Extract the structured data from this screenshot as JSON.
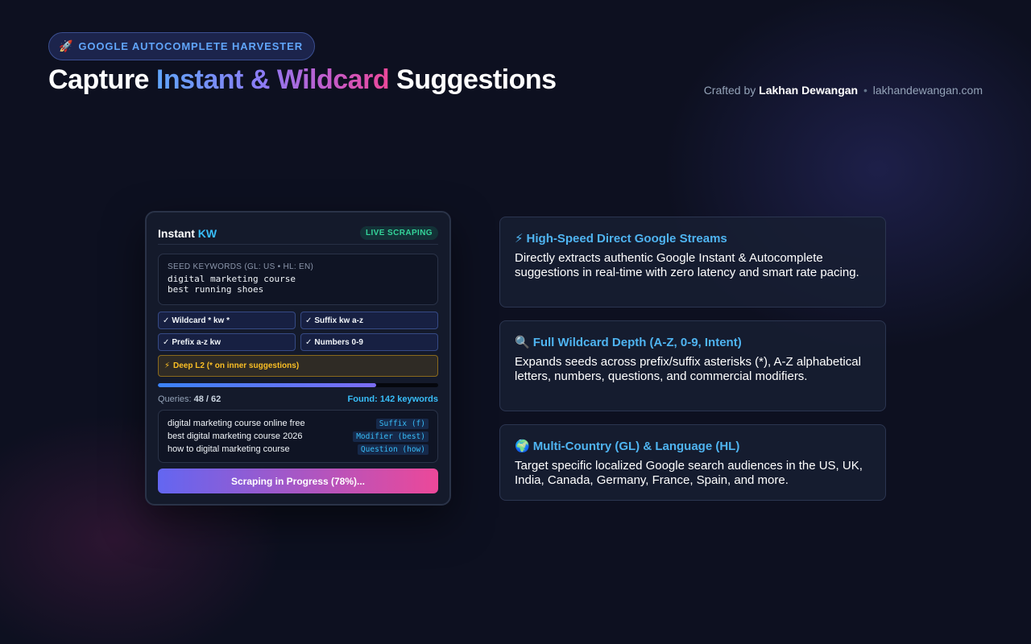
{
  "header": {
    "badge_icon": "rocket-icon",
    "badge_text": "GOOGLE AUTOCOMPLETE HARVESTER",
    "title_pre": "Capture",
    "title_grad": "Instant & Wildcard",
    "title_post": "Suggestions",
    "credit_prefix": "Crafted by",
    "credit_name": "Lakhan Dewangan",
    "credit_sep": "•",
    "credit_site": "lakhandewangan.com"
  },
  "card": {
    "title_main": "Instant",
    "title_accent": "KW",
    "live_badge": "LIVE SCRAPING",
    "seed_label": "SEED KEYWORDS (GL: US • HL: EN)",
    "seed_lines": [
      "digital marketing course",
      "best running shoes"
    ],
    "options": [
      {
        "check": "✓",
        "label": "Wildcard * kw *"
      },
      {
        "check": "✓",
        "label": "Suffix kw a-z"
      },
      {
        "check": "✓",
        "label": "Prefix a-z kw"
      },
      {
        "check": "✓",
        "label": "Numbers 0-9"
      }
    ],
    "deep": {
      "icon": "⚡",
      "label": "Deep L2 (* on inner suggestions)"
    },
    "progress": 0.78,
    "queries_label": "Queries:",
    "queries_value": "48 / 62",
    "found_text": "Found: 142 keywords",
    "results": [
      {
        "keyword": "digital marketing course online free",
        "tag": "Suffix (f)"
      },
      {
        "keyword": "best digital marketing course 2026",
        "tag": "Modifier (best)"
      },
      {
        "keyword": "how to digital marketing course",
        "tag": "Question (how)"
      }
    ],
    "cta": "Scraping in Progress (78%)..."
  },
  "features": [
    {
      "icon": "⚡",
      "icon_name": "lightning-icon",
      "title": "High-Speed Direct Google Streams",
      "desc": "Directly extracts authentic Google Instant & Autocomplete suggestions in real-time with zero latency and smart rate pacing."
    },
    {
      "icon": "🔍",
      "icon_name": "magnifier-icon",
      "title": "Full Wildcard Depth (A-Z, 0-9, Intent)",
      "desc": "Expands seeds across prefix/suffix asterisks (*), A-Z alphabetical letters, numbers, questions, and commercial modifiers."
    },
    {
      "icon": "🌍",
      "icon_name": "globe-icon",
      "title": "Multi-Country (GL) & Language (HL)",
      "desc": "Target specific localized Google search audiences in the US, UK, India, Canada, Germany, France, Spain, and more."
    }
  ]
}
